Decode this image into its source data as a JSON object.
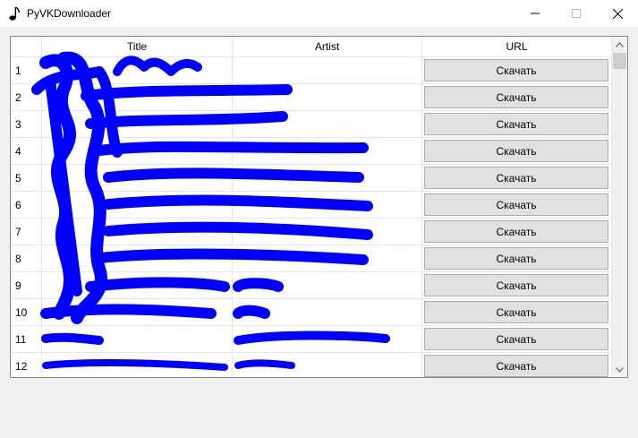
{
  "window": {
    "title": "PyVKDownloader",
    "icon": "music-note-icon"
  },
  "table": {
    "headers": {
      "title": "Title",
      "artist": "Artist",
      "url": "URL"
    },
    "download_label": "Скачать",
    "rows": [
      {
        "num": "1",
        "title": "",
        "artist": ""
      },
      {
        "num": "2",
        "title": "",
        "artist": ""
      },
      {
        "num": "3",
        "title": "",
        "artist": ""
      },
      {
        "num": "4",
        "title": "",
        "artist": ""
      },
      {
        "num": "5",
        "title": "",
        "artist": ""
      },
      {
        "num": "6",
        "title": "",
        "artist": ""
      },
      {
        "num": "7",
        "title": "",
        "artist": ""
      },
      {
        "num": "8",
        "title": "",
        "artist": ""
      },
      {
        "num": "9",
        "title": "",
        "artist": ""
      },
      {
        "num": "10",
        "title": "",
        "artist": ""
      },
      {
        "num": "11",
        "title": "",
        "artist": ""
      },
      {
        "num": "12",
        "title": "",
        "artist": ""
      }
    ]
  },
  "redaction": {
    "color": "#0000ff"
  }
}
